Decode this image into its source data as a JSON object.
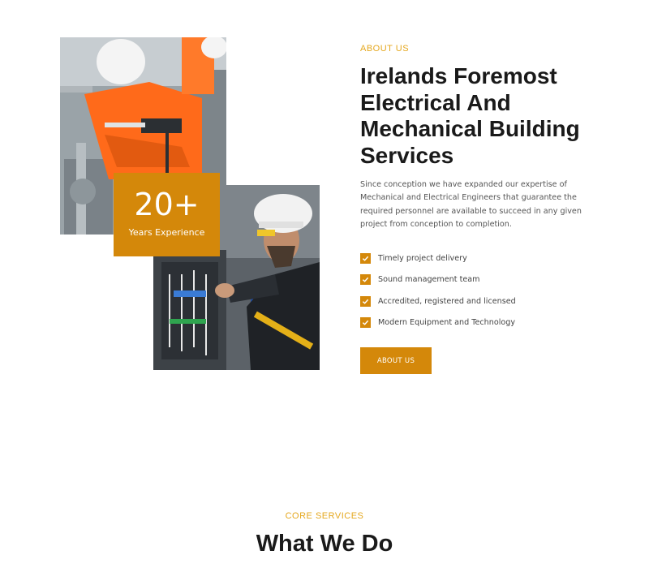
{
  "about": {
    "eyebrow": "ABOUT US",
    "heading": "Irelands Foremost Electrical And Mechanical Building Services",
    "description": "Since conception we have expanded our expertise of Mechanical and Electrical Engineers that guarantee the required personnel are available to succeed in any given project from conception to completion.",
    "features": [
      "Timely project delivery",
      "Sound management team",
      "Accredited, registered and licensed",
      "Modern Equipment and Technology"
    ],
    "button_label": "ABOUT US"
  },
  "experience": {
    "number": "20+",
    "label": "Years Experience"
  },
  "services": {
    "eyebrow": "CORE SERVICES",
    "title": "What We Do"
  },
  "colors": {
    "accent": "#d4880a",
    "eyebrow": "#e5a81f",
    "heading": "#1a1a1a"
  }
}
